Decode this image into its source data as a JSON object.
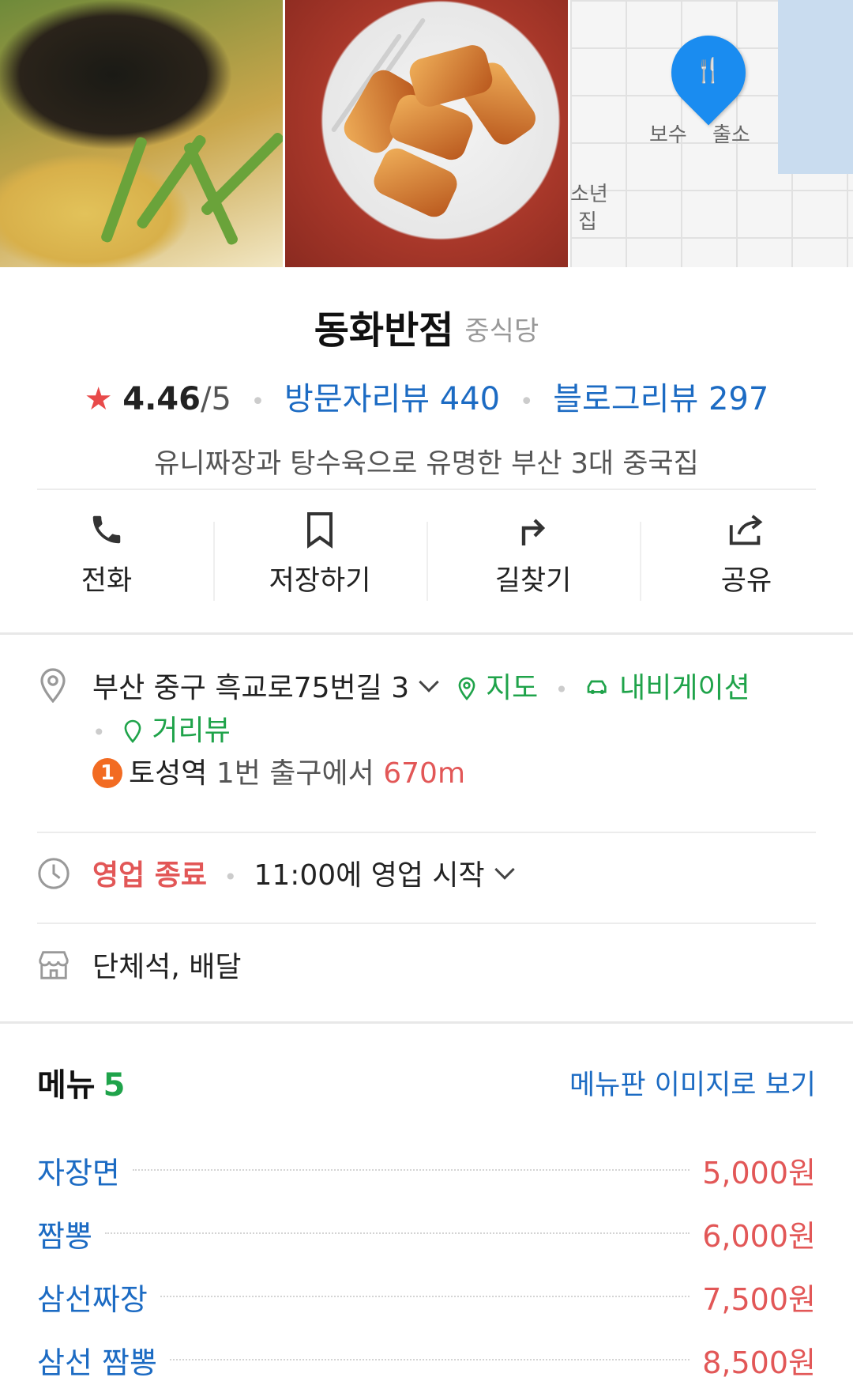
{
  "place": {
    "name": "동화반점",
    "category": "중식당",
    "rating": "4.46",
    "rating_max": "/5",
    "visitor_reviews": "방문자리뷰 440",
    "blog_reviews": "블로그리뷰 297",
    "tagline": "유니짜장과 탕수육으로 유명한 부산 3대 중국집"
  },
  "photos": {
    "map_labels": [
      "보수",
      "출소",
      "소년",
      "집"
    ]
  },
  "actions": [
    {
      "label": "전화",
      "icon": "phone-icon"
    },
    {
      "label": "저장하기",
      "icon": "bookmark-icon"
    },
    {
      "label": "길찾기",
      "icon": "directions-icon"
    },
    {
      "label": "공유",
      "icon": "share-icon"
    }
  ],
  "address": {
    "text": "부산 중구 흑교로75번길 3",
    "map_link": "지도",
    "navigation_link": "내비게이션",
    "street_view_link": "거리뷰",
    "subway_line": "1",
    "station": "토성역",
    "exit": "1번 출구에서",
    "distance": "670m"
  },
  "hours": {
    "status": "영업 종료",
    "next": "11:00에 영업 시작"
  },
  "facilities": "단체석, 배달",
  "menu": {
    "title": "메뉴",
    "count": "5",
    "image_link": "메뉴판 이미지로 보기",
    "items": [
      {
        "name": "자장면",
        "price": "5,000원"
      },
      {
        "name": "짬뽕",
        "price": "6,000원"
      },
      {
        "name": "삼선짜장",
        "price": "7,500원"
      },
      {
        "name": "삼선 짬뽕",
        "price": "8,500원"
      }
    ]
  },
  "colors": {
    "link_blue": "#1c6bc3",
    "green": "#1fa34a",
    "red": "#e25757",
    "pin_blue": "#1a8cf0"
  }
}
